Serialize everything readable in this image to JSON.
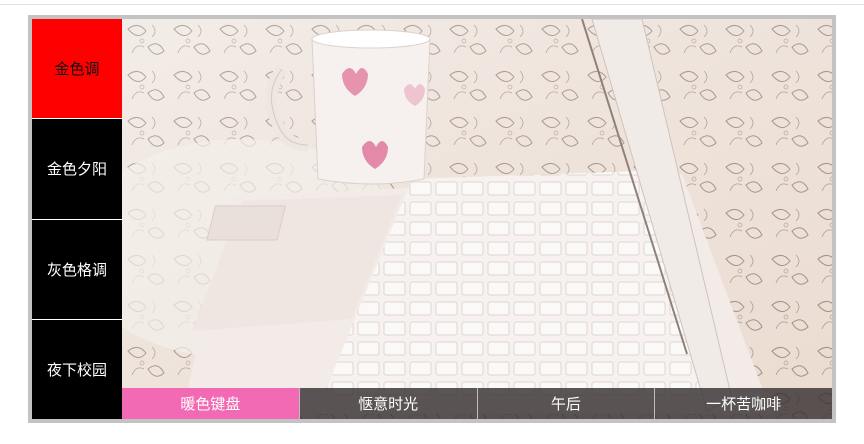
{
  "sidebar": {
    "items": [
      {
        "label": "金色调",
        "active": true
      },
      {
        "label": "金色夕阳",
        "active": false
      },
      {
        "label": "灰色格调",
        "active": false
      },
      {
        "label": "夜下校园",
        "active": false
      }
    ]
  },
  "slide": {
    "image_subject": "white laptop keyboard and heart-patterned mug on floral bedding"
  },
  "bottom_tabs": {
    "items": [
      {
        "label": "暖色键盘",
        "active": true
      },
      {
        "label": "惬意时光",
        "active": false
      },
      {
        "label": "午后",
        "active": false
      },
      {
        "label": "一杯苦咖啡",
        "active": false
      }
    ]
  },
  "colors": {
    "sidebar_active": "#ff0000",
    "sidebar_inactive": "#000000",
    "tab_active": "#f36ab4",
    "frame_border": "#c3c3c3"
  }
}
